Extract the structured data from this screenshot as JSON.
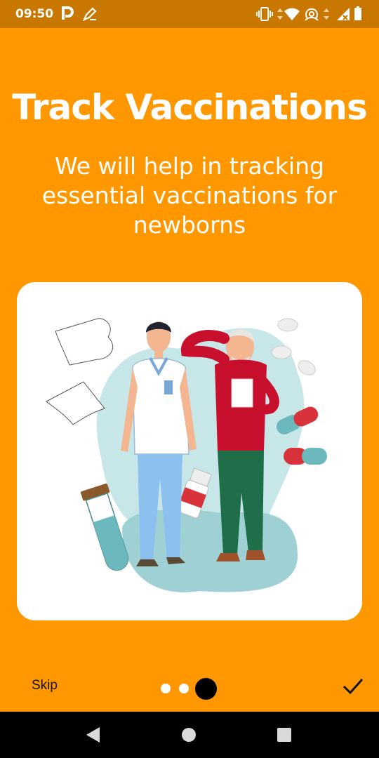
{
  "status_bar": {
    "time": "09:50",
    "icons": [
      "parking-icon",
      "pen-icon",
      "vibrate-icon",
      "wifi-icon",
      "hotspot-icon",
      "signal-icon",
      "battery-icon"
    ]
  },
  "onboarding": {
    "title": "Track Vaccinations",
    "subtitle_lines": [
      "We will help in tracking",
      "essential vaccinations for",
      "newborns"
    ],
    "illustration": "doctor-and-elderly-patient-illustration",
    "page_indicator": {
      "total": 3,
      "current": 3
    },
    "skip_label": "Skip",
    "done_icon": "check-icon"
  },
  "navigation_bar": {
    "buttons": [
      "back-icon",
      "home-icon",
      "recents-icon"
    ]
  },
  "colors": {
    "background": "#FF9800",
    "status_bar": "#C87700",
    "card": "#FFFFFF",
    "nav_bar": "#000000"
  }
}
